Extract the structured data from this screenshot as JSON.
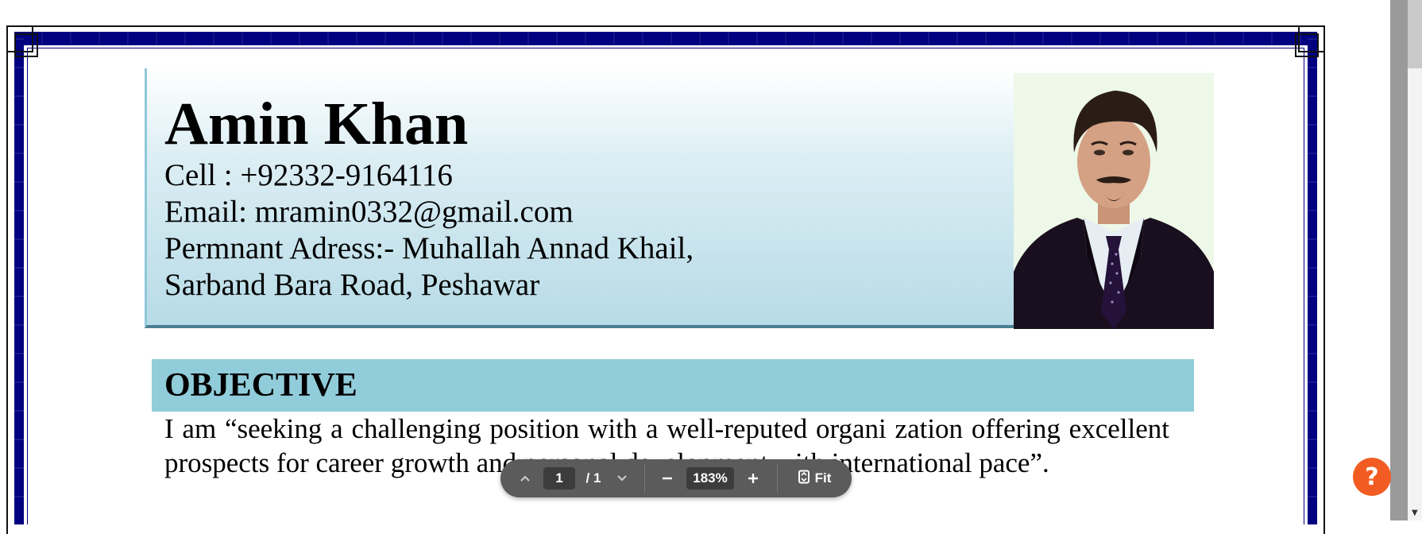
{
  "resume": {
    "name": "Amin Khan",
    "contact": {
      "cell": "Cell : +92332-9164116",
      "email": "Email: mramin0332@gmail.com",
      "address_line1": "Permnant Adress:- Muhallah Annad Khail,",
      "address_line2": "Sarband Bara Road, Peshawar"
    },
    "objective": {
      "title": "OBJECTIVE",
      "text": "I am “seeking a challenging position with a well-reputed organi zation offering excellent prospects for career growth and personal development with international pace”."
    }
  },
  "viewer": {
    "page_current": "1",
    "page_total": "/ 1",
    "zoom": "183%",
    "fit_label": "Fit"
  },
  "help": {
    "label": "?"
  },
  "colors": {
    "frame_navy": "#000080",
    "section_band": "#91ccda",
    "toolbar_bg": "#5b5b5b",
    "help_orange": "#f25c22"
  },
  "icons": {
    "prev_page": "chevron-up-icon",
    "next_page": "chevron-down-icon",
    "zoom_out": "minus-icon",
    "zoom_in": "plus-icon",
    "fit": "fit-page-icon",
    "help": "help-icon"
  }
}
